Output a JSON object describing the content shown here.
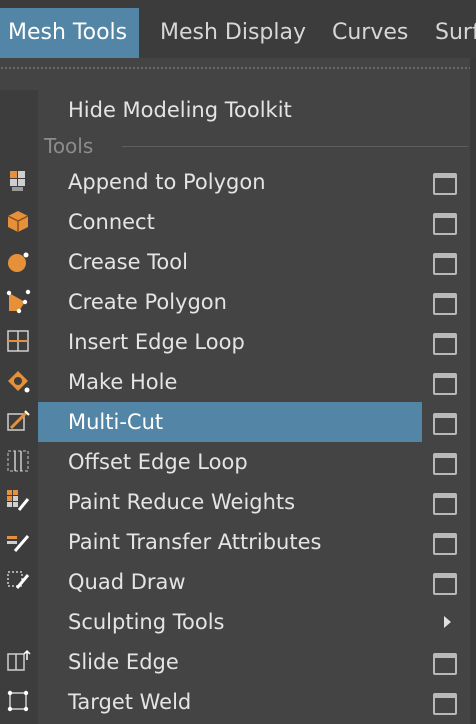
{
  "menubar": {
    "items": [
      {
        "label": "Mesh Tools",
        "active": true
      },
      {
        "label": "Mesh Display"
      },
      {
        "label": "Curves"
      },
      {
        "label": "Surf"
      }
    ]
  },
  "menu": {
    "top_item": "Hide Modeling Toolkit",
    "section_label": "Tools",
    "items": [
      {
        "label": "Append to Polygon",
        "icon": "append-polygon-icon",
        "option_box": true
      },
      {
        "label": "Connect",
        "icon": "connect-icon",
        "option_box": true
      },
      {
        "label": "Crease Tool",
        "icon": "crease-tool-icon",
        "option_box": true
      },
      {
        "label": "Create Polygon",
        "icon": "create-polygon-icon",
        "option_box": true
      },
      {
        "label": "Insert Edge Loop",
        "icon": "insert-edge-loop-icon",
        "option_box": true
      },
      {
        "label": "Make Hole",
        "icon": "make-hole-icon",
        "option_box": true
      },
      {
        "label": "Multi-Cut",
        "icon": "multi-cut-icon",
        "option_box": true,
        "highlighted": true
      },
      {
        "label": "Offset Edge Loop",
        "icon": "offset-edge-loop-icon",
        "option_box": true
      },
      {
        "label": "Paint Reduce Weights",
        "icon": "paint-reduce-weights-icon",
        "option_box": true
      },
      {
        "label": "Paint Transfer Attributes",
        "icon": "paint-transfer-attributes-icon",
        "option_box": true
      },
      {
        "label": "Quad Draw",
        "icon": "quad-draw-icon",
        "option_box": true
      },
      {
        "label": "Sculpting Tools",
        "icon": "",
        "submenu": true
      },
      {
        "label": "Slide Edge",
        "icon": "slide-edge-icon",
        "option_box": true
      },
      {
        "label": "Target Weld",
        "icon": "target-weld-icon",
        "option_box": true
      }
    ]
  },
  "colors": {
    "highlight": "#5285a6",
    "menu_bg": "#444444",
    "text": "#e4e4e4",
    "section_text": "#8c8c8c",
    "icon_orange": "#e6913a"
  }
}
